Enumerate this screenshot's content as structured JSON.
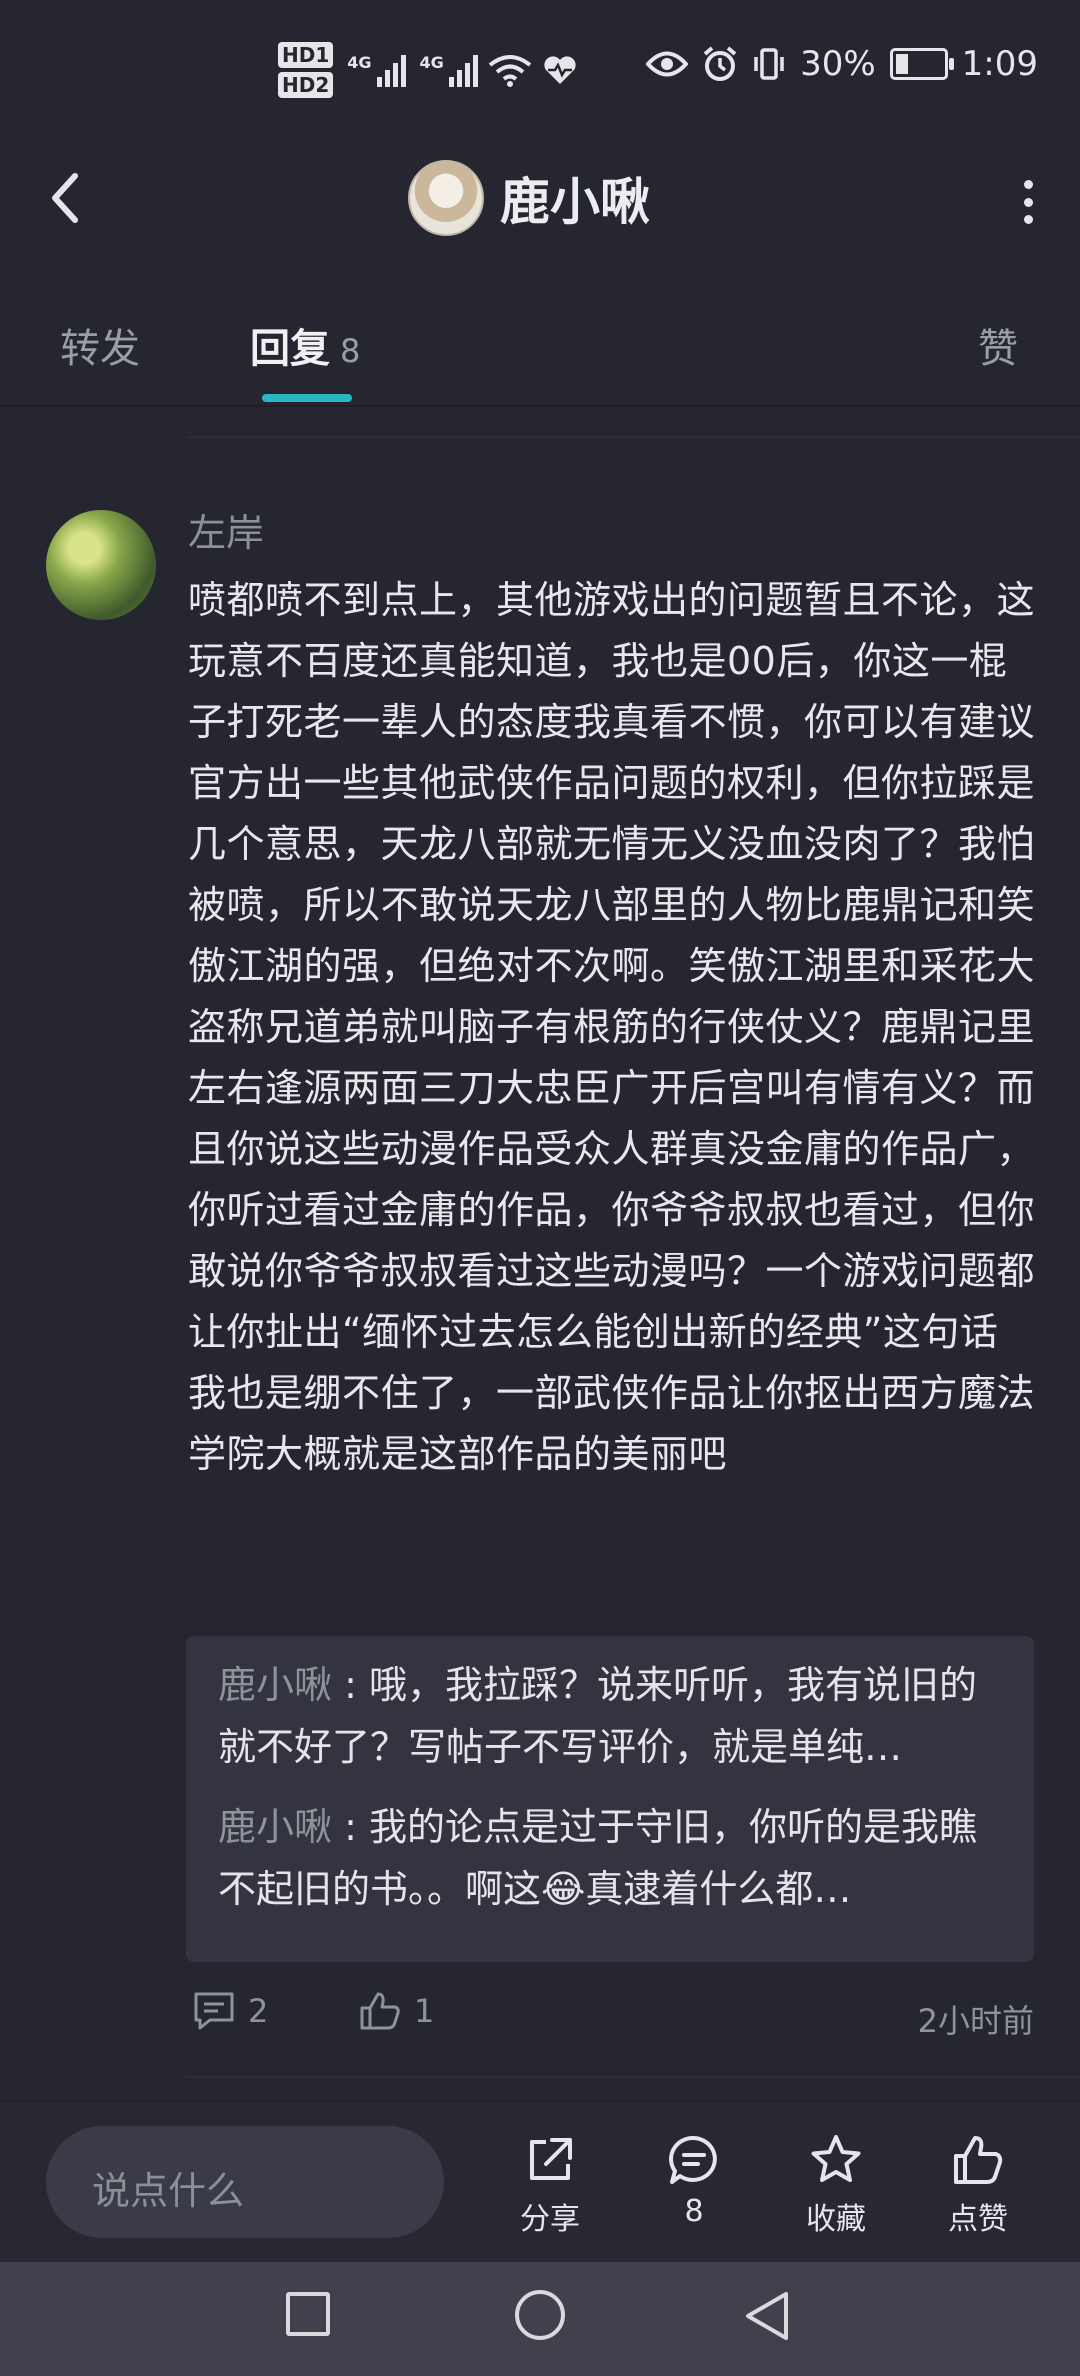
{
  "status_bar": {
    "hd1": "HD1",
    "hd2": "HD2",
    "net1": "4G",
    "net2": "4G",
    "battery_text": "30%",
    "battery_level": 0.3,
    "time": "1:09"
  },
  "header": {
    "title": "鹿小啾"
  },
  "tabs": {
    "forward": "转发",
    "reply": "回复",
    "reply_count": "8",
    "like": "赞"
  },
  "comment": {
    "author": "左岸",
    "text": "喷都喷不到点上，其他游戏出的问题暂且不论，这玩意不百度还真能知道，我也是00后，你这一棍子打死老一辈人的态度我真看不惯，你可以有建议官方出一些其他武侠作品问题的权利，但你拉踩是几个意思，天龙八部就无情无义没血没肉了？我怕被喷，所以不敢说天龙八部里的人物比鹿鼎记和笑傲江湖的强，但绝对不次啊。笑傲江湖里和采花大盗称兄道弟就叫脑子有根筋的行侠仗义？鹿鼎记里左右逢源两面三刀大忠臣广开后宫叫有情有义？而且你说这些动漫作品受众人群真没金庸的作品广，你听过看过金庸的作品，你爷爷叔叔也看过，但你敢说你爷爷叔叔看过这些动漫吗？一个游戏问题都让你扯出“缅怀过去怎么能创出新的经典”这句话我也是绷不住了，一部武侠作品让你抠出西方魔法学院大概就是这部作品的美丽吧",
    "replies": [
      {
        "name": "鹿小啾",
        "sep": " : ",
        "text": "哦，我拉踩？说来听听，我有说旧的就不好了？写帖子不写评价，就是单纯…"
      },
      {
        "name": "鹿小啾",
        "sep": " : ",
        "text": "我的论点是过于守旧，你听的是我瞧不起旧的书。。啊这😂真逮着什么都…"
      }
    ],
    "reply_count": "2",
    "like_count": "1",
    "time": "2小时前"
  },
  "bottom_bar": {
    "input_placeholder": "说点什么",
    "share": "分享",
    "comments": "8",
    "favorite": "收藏",
    "like": "点赞"
  }
}
